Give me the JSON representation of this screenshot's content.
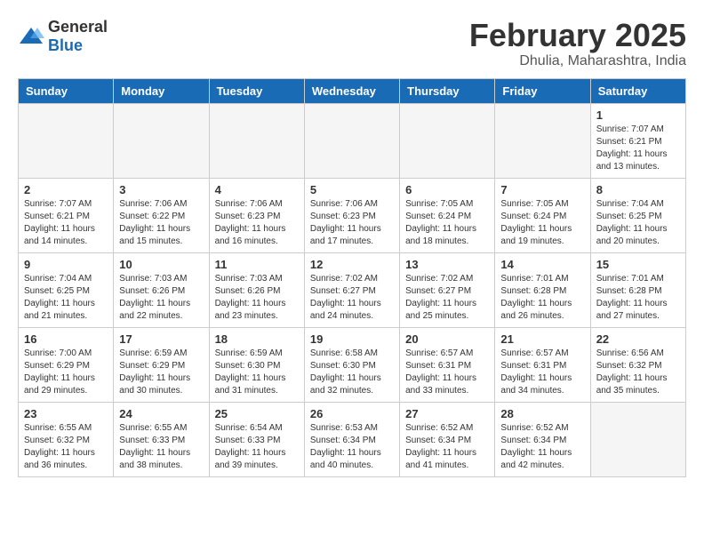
{
  "logo": {
    "text_general": "General",
    "text_blue": "Blue"
  },
  "title": "February 2025",
  "location": "Dhulia, Maharashtra, India",
  "days_of_week": [
    "Sunday",
    "Monday",
    "Tuesday",
    "Wednesday",
    "Thursday",
    "Friday",
    "Saturday"
  ],
  "weeks": [
    [
      {
        "day": "",
        "info": ""
      },
      {
        "day": "",
        "info": ""
      },
      {
        "day": "",
        "info": ""
      },
      {
        "day": "",
        "info": ""
      },
      {
        "day": "",
        "info": ""
      },
      {
        "day": "",
        "info": ""
      },
      {
        "day": "1",
        "info": "Sunrise: 7:07 AM\nSunset: 6:21 PM\nDaylight: 11 hours\nand 13 minutes."
      }
    ],
    [
      {
        "day": "2",
        "info": "Sunrise: 7:07 AM\nSunset: 6:21 PM\nDaylight: 11 hours\nand 14 minutes."
      },
      {
        "day": "3",
        "info": "Sunrise: 7:06 AM\nSunset: 6:22 PM\nDaylight: 11 hours\nand 15 minutes."
      },
      {
        "day": "4",
        "info": "Sunrise: 7:06 AM\nSunset: 6:23 PM\nDaylight: 11 hours\nand 16 minutes."
      },
      {
        "day": "5",
        "info": "Sunrise: 7:06 AM\nSunset: 6:23 PM\nDaylight: 11 hours\nand 17 minutes."
      },
      {
        "day": "6",
        "info": "Sunrise: 7:05 AM\nSunset: 6:24 PM\nDaylight: 11 hours\nand 18 minutes."
      },
      {
        "day": "7",
        "info": "Sunrise: 7:05 AM\nSunset: 6:24 PM\nDaylight: 11 hours\nand 19 minutes."
      },
      {
        "day": "8",
        "info": "Sunrise: 7:04 AM\nSunset: 6:25 PM\nDaylight: 11 hours\nand 20 minutes."
      }
    ],
    [
      {
        "day": "9",
        "info": "Sunrise: 7:04 AM\nSunset: 6:25 PM\nDaylight: 11 hours\nand 21 minutes."
      },
      {
        "day": "10",
        "info": "Sunrise: 7:03 AM\nSunset: 6:26 PM\nDaylight: 11 hours\nand 22 minutes."
      },
      {
        "day": "11",
        "info": "Sunrise: 7:03 AM\nSunset: 6:26 PM\nDaylight: 11 hours\nand 23 minutes."
      },
      {
        "day": "12",
        "info": "Sunrise: 7:02 AM\nSunset: 6:27 PM\nDaylight: 11 hours\nand 24 minutes."
      },
      {
        "day": "13",
        "info": "Sunrise: 7:02 AM\nSunset: 6:27 PM\nDaylight: 11 hours\nand 25 minutes."
      },
      {
        "day": "14",
        "info": "Sunrise: 7:01 AM\nSunset: 6:28 PM\nDaylight: 11 hours\nand 26 minutes."
      },
      {
        "day": "15",
        "info": "Sunrise: 7:01 AM\nSunset: 6:28 PM\nDaylight: 11 hours\nand 27 minutes."
      }
    ],
    [
      {
        "day": "16",
        "info": "Sunrise: 7:00 AM\nSunset: 6:29 PM\nDaylight: 11 hours\nand 29 minutes."
      },
      {
        "day": "17",
        "info": "Sunrise: 6:59 AM\nSunset: 6:29 PM\nDaylight: 11 hours\nand 30 minutes."
      },
      {
        "day": "18",
        "info": "Sunrise: 6:59 AM\nSunset: 6:30 PM\nDaylight: 11 hours\nand 31 minutes."
      },
      {
        "day": "19",
        "info": "Sunrise: 6:58 AM\nSunset: 6:30 PM\nDaylight: 11 hours\nand 32 minutes."
      },
      {
        "day": "20",
        "info": "Sunrise: 6:57 AM\nSunset: 6:31 PM\nDaylight: 11 hours\nand 33 minutes."
      },
      {
        "day": "21",
        "info": "Sunrise: 6:57 AM\nSunset: 6:31 PM\nDaylight: 11 hours\nand 34 minutes."
      },
      {
        "day": "22",
        "info": "Sunrise: 6:56 AM\nSunset: 6:32 PM\nDaylight: 11 hours\nand 35 minutes."
      }
    ],
    [
      {
        "day": "23",
        "info": "Sunrise: 6:55 AM\nSunset: 6:32 PM\nDaylight: 11 hours\nand 36 minutes."
      },
      {
        "day": "24",
        "info": "Sunrise: 6:55 AM\nSunset: 6:33 PM\nDaylight: 11 hours\nand 38 minutes."
      },
      {
        "day": "25",
        "info": "Sunrise: 6:54 AM\nSunset: 6:33 PM\nDaylight: 11 hours\nand 39 minutes."
      },
      {
        "day": "26",
        "info": "Sunrise: 6:53 AM\nSunset: 6:34 PM\nDaylight: 11 hours\nand 40 minutes."
      },
      {
        "day": "27",
        "info": "Sunrise: 6:52 AM\nSunset: 6:34 PM\nDaylight: 11 hours\nand 41 minutes."
      },
      {
        "day": "28",
        "info": "Sunrise: 6:52 AM\nSunset: 6:34 PM\nDaylight: 11 hours\nand 42 minutes."
      },
      {
        "day": "",
        "info": ""
      }
    ]
  ]
}
